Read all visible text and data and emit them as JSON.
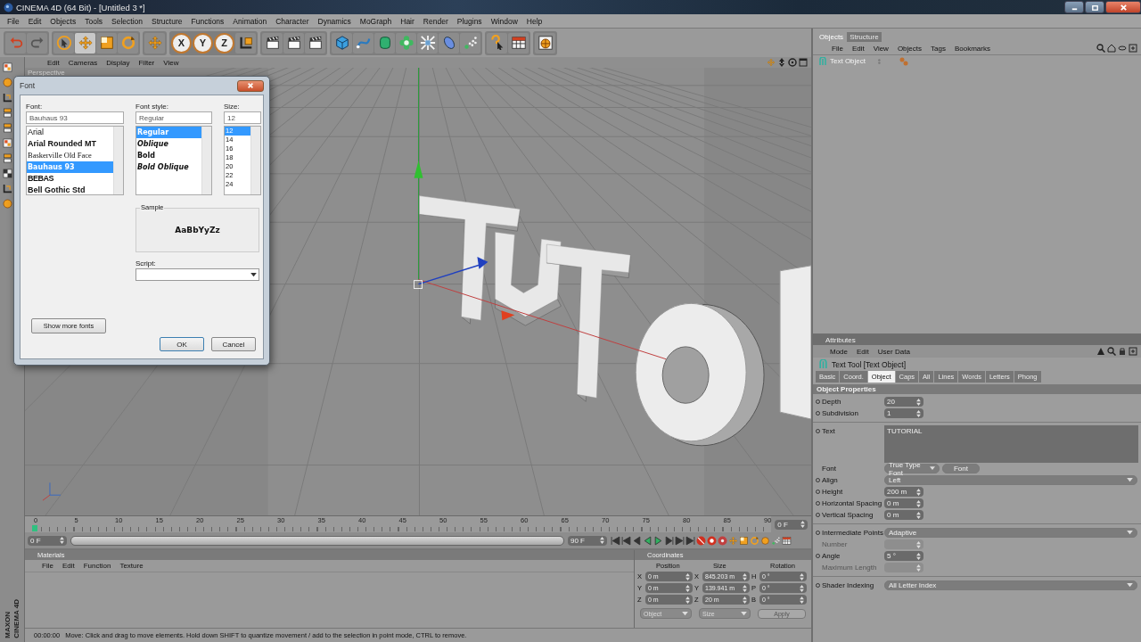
{
  "window": {
    "title": "CINEMA 4D (64 Bit) - [Untitled 3 *]"
  },
  "menu": [
    "File",
    "Edit",
    "Objects",
    "Tools",
    "Selection",
    "Structure",
    "Functions",
    "Animation",
    "Character",
    "Dynamics",
    "MoGraph",
    "Hair",
    "Render",
    "Plugins",
    "Window",
    "Help"
  ],
  "axis_buttons": [
    "X",
    "Y",
    "Z"
  ],
  "viewport": {
    "menu": [
      "Edit",
      "Cameras",
      "Display",
      "Filter",
      "View"
    ],
    "label": "Perspective"
  },
  "font_dialog": {
    "title": "Font",
    "font_label": "Font:",
    "font_value": "Bauhaus 93",
    "fonts": [
      {
        "label": "Arial",
        "kind": "plain",
        "selected": false
      },
      {
        "label": "Arial Rounded MT",
        "kind": "bold",
        "selected": false
      },
      {
        "label": "Baskerville Old Face",
        "kind": "serif",
        "selected": false
      },
      {
        "label": "Bauhaus 93",
        "kind": "heavy",
        "selected": true
      },
      {
        "label": "BEBAS",
        "kind": "condensed",
        "selected": false
      },
      {
        "label": "Bell Gothic Std",
        "kind": "bold",
        "selected": false
      }
    ],
    "style_label": "Font style:",
    "style_value": "Regular",
    "styles": [
      {
        "label": "Regular",
        "kind": "regular",
        "selected": true
      },
      {
        "label": "Oblique",
        "kind": "oblique",
        "selected": false
      },
      {
        "label": "Bold",
        "kind": "regular",
        "selected": false
      },
      {
        "label": "Bold Oblique",
        "kind": "oblique",
        "selected": false
      }
    ],
    "size_label": "Size:",
    "size_value": "12",
    "sizes": [
      {
        "label": "12",
        "selected": true
      },
      {
        "label": "14",
        "selected": false
      },
      {
        "label": "16",
        "selected": false
      },
      {
        "label": "18",
        "selected": false
      },
      {
        "label": "20",
        "selected": false
      },
      {
        "label": "22",
        "selected": false
      },
      {
        "label": "24",
        "selected": false
      }
    ],
    "sample_label": "Sample",
    "sample_text": "AaBbYyZz",
    "script_label": "Script:",
    "show_more": "Show more fonts",
    "ok": "OK",
    "cancel": "Cancel"
  },
  "objects_manager": {
    "tabs": [
      {
        "label": "Objects",
        "selected": true
      },
      {
        "label": "Structure",
        "selected": false
      }
    ],
    "menu": [
      "File",
      "Edit",
      "View",
      "Objects",
      "Tags",
      "Bookmarks"
    ],
    "objects": [
      {
        "name": "Text Object"
      }
    ]
  },
  "attributes": {
    "title": "Attributes",
    "menu": [
      "Mode",
      "Edit",
      "User Data"
    ],
    "object_title": "Text Tool [Text Object]",
    "tabs": [
      {
        "label": "Basic",
        "selected": false
      },
      {
        "label": "Coord.",
        "selected": false
      },
      {
        "label": "Object",
        "selected": true
      },
      {
        "label": "Caps",
        "selected": false
      },
      {
        "label": "All",
        "selected": false
      },
      {
        "label": "Lines",
        "selected": false
      },
      {
        "label": "Words",
        "selected": false
      },
      {
        "label": "Letters",
        "selected": false
      },
      {
        "label": "Phong",
        "selected": false
      }
    ],
    "section": "Object Properties",
    "fields": [
      {
        "kind": "number",
        "label": "Depth",
        "value": "20",
        "animatable": true,
        "disabled": false,
        "group_start": false
      },
      {
        "kind": "number",
        "label": "Subdivision",
        "value": "1",
        "animatable": true,
        "disabled": false,
        "group_start": false
      },
      {
        "kind": "text",
        "label": "Text",
        "value": "TUTORIAL",
        "animatable": true,
        "disabled": false,
        "group_start": true
      },
      {
        "kind": "font",
        "label": "Font",
        "value": "True Type Font",
        "button": "Font",
        "animatable": false,
        "disabled": false,
        "group_start": false
      },
      {
        "kind": "dropdown",
        "label": "Align",
        "value": "Left",
        "animatable": true,
        "disabled": false,
        "group_start": false
      },
      {
        "kind": "number",
        "label": "Height",
        "value": "200 m",
        "animatable": true,
        "disabled": false,
        "group_start": false
      },
      {
        "kind": "number",
        "label": "Horizontal Spacing",
        "value": "0 m",
        "animatable": true,
        "disabled": false,
        "group_start": false
      },
      {
        "kind": "number",
        "label": "Vertical Spacing",
        "value": "0 m",
        "animatable": true,
        "disabled": false,
        "group_start": false
      },
      {
        "kind": "dropdown",
        "label": "Intermediate Points",
        "value": "Adaptive",
        "animatable": true,
        "disabled": false,
        "group_start": true
      },
      {
        "kind": "number",
        "label": "Number",
        "animatable": false,
        "disabled": true,
        "group_start": false
      },
      {
        "kind": "number",
        "label": "Angle",
        "value": "5 °",
        "animatable": true,
        "disabled": false,
        "group_start": false
      },
      {
        "kind": "number",
        "label": "Maximum Length",
        "animatable": false,
        "disabled": true,
        "group_start": false
      },
      {
        "kind": "dropdown",
        "label": "Shader Indexing",
        "value": "All Letter Index",
        "animatable": true,
        "disabled": false,
        "group_start": true
      }
    ]
  },
  "timeline": {
    "range": {
      "level": 1
    },
    "ticks": [
      "0",
      "5",
      "10",
      "15",
      "20",
      "25",
      "30",
      "35",
      "40",
      "45",
      "50",
      "55",
      "60",
      "65",
      "70",
      "75",
      "80",
      "85",
      "90"
    ],
    "current_frame": "0 F",
    "start": "0 F",
    "end": "90 F"
  },
  "materials": {
    "title": "Materials",
    "menu": [
      "File",
      "Edit",
      "Function",
      "Texture"
    ]
  },
  "coordinates": {
    "title": "Coordinates",
    "columns": [
      "Position",
      "Size",
      "Rotation"
    ],
    "rows": [
      {
        "axes": [
          "X",
          "X",
          "H"
        ],
        "values": [
          "0 m",
          "845.203 m",
          "0 °"
        ]
      },
      {
        "axes": [
          "Y",
          "Y",
          "P"
        ],
        "values": [
          "0 m",
          "139.941 m",
          "0 °"
        ]
      },
      {
        "axes": [
          "Z",
          "Z",
          "B"
        ],
        "values": [
          "0 m",
          "20 m",
          "0 °"
        ]
      }
    ],
    "dropdowns": [
      "Object",
      "Size"
    ],
    "apply": "Apply"
  },
  "status_bar": {
    "time": "00:00:00",
    "message": "Move: Click and drag to move elements. Hold down SHIFT to quantize movement / add to the selection in point mode, CTRL to remove."
  },
  "brand": [
    "MAXON",
    "CINEMA 4D"
  ]
}
